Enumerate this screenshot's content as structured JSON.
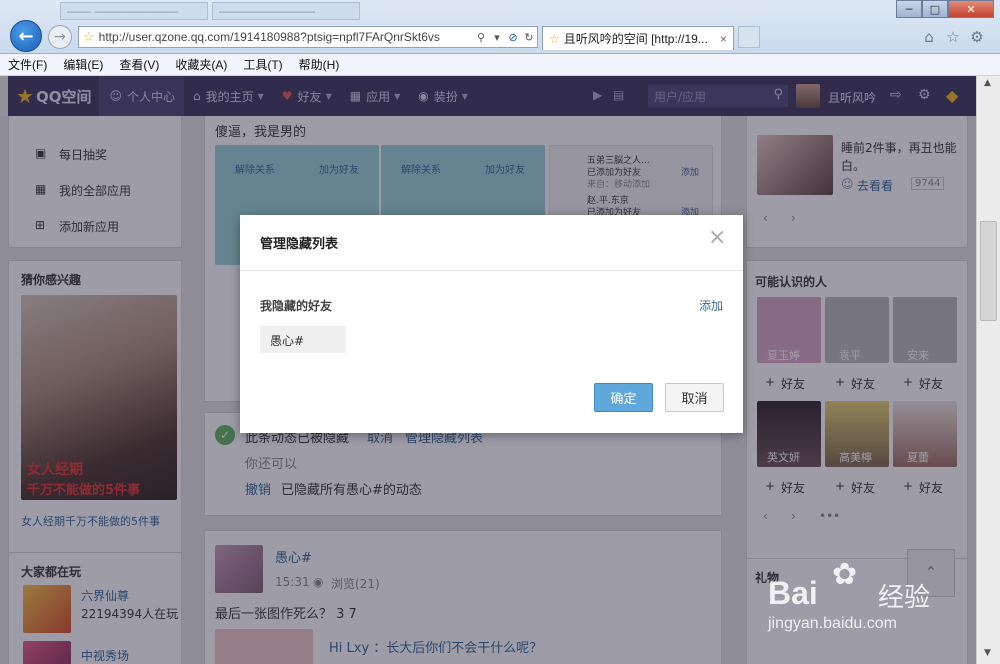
{
  "browser": {
    "tab1": "—— ———————",
    "tab2": "————————",
    "url": "http://user.qzone.qq.com/1914180988?ptsig=npfl7FArQnrSkt6vs",
    "active_tab": "且听风吟的空间 [http://19...",
    "close_glyph": "×"
  },
  "menubar": [
    "文件(F)",
    "编辑(E)",
    "查看(V)",
    "收藏夹(A)",
    "工具(T)",
    "帮助(H)"
  ],
  "qnav": {
    "logo": "QQ空间",
    "items": [
      "个人中心",
      "我的主页",
      "好友",
      "应用",
      "装扮"
    ],
    "search_placeholder": "用户/应用",
    "username": "且听风吟"
  },
  "left": {
    "menu": [
      "每日抽奖",
      "我的全部应用",
      "添加新应用"
    ],
    "interest_title": "猜你感兴趣",
    "ad_overlay1": "女人经期",
    "ad_overlay2": "千万不能做的5件事",
    "ad_caption": "女人经期千万不能做的5件事",
    "playing_title": "大家都在玩",
    "game1_name": "六界仙尊",
    "game1_count": "22194394人在玩",
    "game2_name": "中视秀场"
  },
  "center": {
    "post_text": "傻逼，我是男的",
    "btn_unfriend": "解除关系",
    "btn_addfriend": "加为好友",
    "hidden_msg": "此条动态已被隐藏",
    "cancel": "取消",
    "manage": "管理隐藏列表",
    "you_can": "你还可以",
    "undo": "撤销",
    "hidden_all": "已隐藏所有愚心#的动态",
    "poster": "愚心#",
    "time": "15:31",
    "views": "浏览(21)",
    "post2_text": "最后一张图作死么？ 3 7",
    "quote": "Hi Lxy ：长大后你们不会干什么呢？",
    "chat1_name": "五弟三脳之人...",
    "chat1_sub": "已添加为好友",
    "chat1_sub2": "来自：移动添加",
    "chat2_name": "赵.平.东京",
    "chat2_sub": "已添加为好友",
    "add_btn": "添加"
  },
  "right": {
    "status": "睡前2件事，再丑也能白。",
    "go_see": "去看看",
    "see_count": "9744",
    "may_know": "可能认识的人",
    "people": [
      "夏玉婷",
      "袁平",
      "安来",
      "英文妍",
      "高美檸",
      "夏蕾"
    ],
    "add_friend": "好友",
    "gifts": "礼物",
    "dots": "•••"
  },
  "modal": {
    "title": "管理隐藏列表",
    "close": "×",
    "subtitle": "我隐藏的好友",
    "add": "添加",
    "friends": [
      "愚心#"
    ],
    "ok": "确定",
    "cancel": "取消"
  },
  "watermark": {
    "brand": "Bai",
    "brand2": "经验",
    "url": "jingyan.baidu.com"
  },
  "colors": {
    "nav_bg": "#3a3358",
    "ok_button": "#5fa8dc",
    "link": "#2f6497"
  }
}
